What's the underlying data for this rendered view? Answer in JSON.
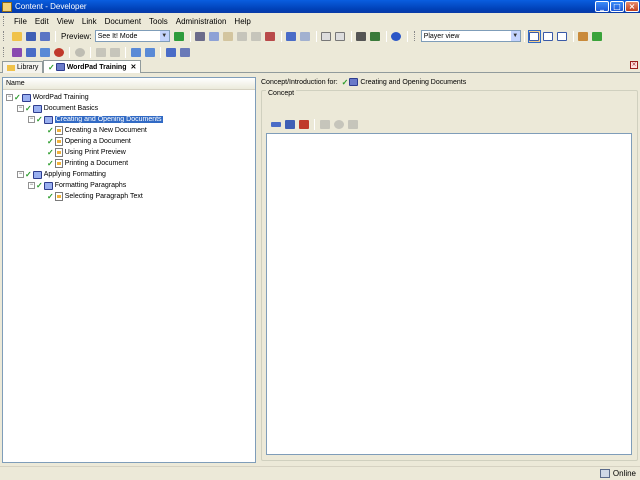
{
  "window": {
    "title": "Content - Developer"
  },
  "menu": [
    "File",
    "Edit",
    "View",
    "Link",
    "Document",
    "Tools",
    "Administration",
    "Help"
  ],
  "toolbar": {
    "preview_label": "Preview:",
    "preview_mode": "See It! Mode",
    "player_view": "Player view"
  },
  "tabs": [
    {
      "label": "Library"
    },
    {
      "label": "WordPad Training",
      "close": "✕"
    }
  ],
  "tree": {
    "header": "Name",
    "items": [
      {
        "label": "WordPad Training",
        "type": "book"
      },
      {
        "label": "Document Basics",
        "type": "book"
      },
      {
        "label": "Creating and Opening Documents",
        "type": "book"
      },
      {
        "label": "Creating a New Document",
        "type": "page"
      },
      {
        "label": "Opening a Document",
        "type": "page"
      },
      {
        "label": "Using Print Preview",
        "type": "page"
      },
      {
        "label": "Printing a Document",
        "type": "page"
      },
      {
        "label": "Applying Formatting",
        "type": "book"
      },
      {
        "label": "Formatting Paragraphs",
        "type": "book"
      },
      {
        "label": "Selecting Paragraph Text",
        "type": "page"
      }
    ]
  },
  "concept": {
    "intro_label": "Concept/Introduction for:",
    "intro_target": "Creating and Opening Documents",
    "group_title": "Concept"
  },
  "status": {
    "text": "Online"
  },
  "colors": {
    "selection": "#316ac5",
    "check": "#2a9b2a",
    "titlebar": "#0a5ee0"
  }
}
